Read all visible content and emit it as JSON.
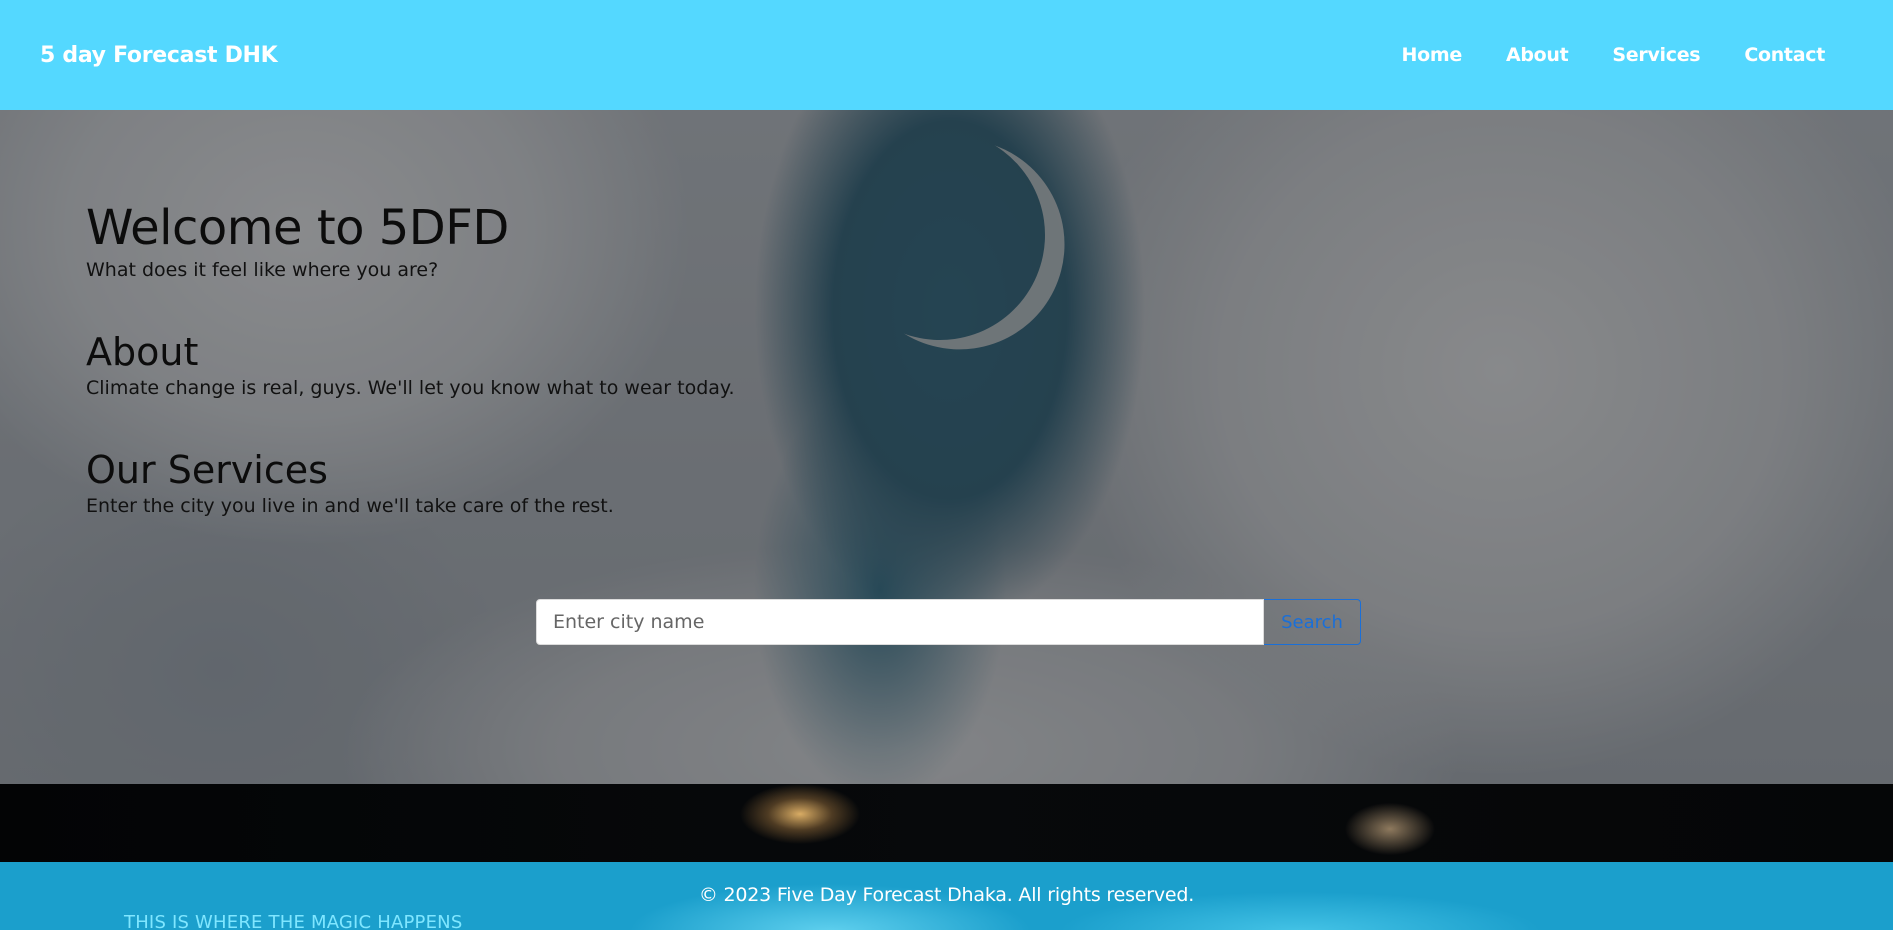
{
  "header": {
    "brand": "5 day Forecast DHK",
    "nav": [
      "Home",
      "About",
      "Services",
      "Contact"
    ]
  },
  "hero": {
    "welcome_title": "Welcome to 5DFD",
    "welcome_text": "What does it feel like where you are?",
    "about_title": "About",
    "about_text": "Climate change is real, guys. We'll let you know what to wear today.",
    "services_title": "Our Services",
    "services_text": "Enter the city you live in and we'll take care of the rest."
  },
  "search": {
    "placeholder": "Enter city name",
    "button_label": "Search"
  },
  "footer": {
    "copyright": "© 2023 Five Day Forecast Dhaka. All rights reserved.",
    "tagline": "THIS IS WHERE THE MAGIC HAPPENS"
  },
  "colors": {
    "header_bg": "#54d8ff",
    "footer_bg": "#1b9fcc",
    "search_button": "#1a6fd8"
  }
}
